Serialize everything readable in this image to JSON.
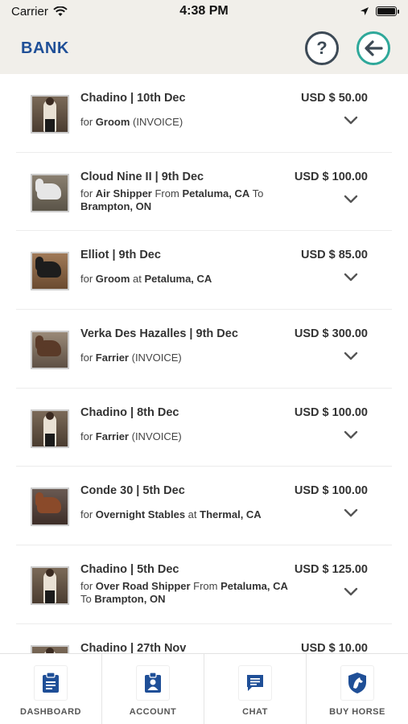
{
  "status": {
    "carrier": "Carrier",
    "time": "4:38 PM"
  },
  "header": {
    "title": "BANK",
    "help_label": "?"
  },
  "transactions": [
    {
      "title": "Chadino | 10th Dec",
      "amount": "USD $ 50.00",
      "sub": [
        "for ",
        {
          "b": "Groom"
        },
        " (INVOICE)"
      ]
    },
    {
      "title": "Cloud Nine II | 9th Dec",
      "amount": "USD $ 100.00",
      "sub": [
        "for ",
        {
          "b": "Air Shipper"
        },
        " From ",
        {
          "b": "Petaluma, CA"
        },
        " To ",
        {
          "b": "Brampton, ON"
        }
      ]
    },
    {
      "title": "Elliot | 9th Dec",
      "amount": "USD $ 85.00",
      "sub": [
        "for ",
        {
          "b": "Groom"
        },
        " at ",
        {
          "b": "Petaluma, CA"
        }
      ]
    },
    {
      "title": "Verka Des Hazalles | 9th Dec",
      "amount": "USD $ 300.00",
      "sub": [
        "for ",
        {
          "b": "Farrier"
        },
        " (INVOICE)"
      ]
    },
    {
      "title": "Chadino | 8th Dec",
      "amount": "USD $ 100.00",
      "sub": [
        "for ",
        {
          "b": "Farrier"
        },
        " (INVOICE)"
      ]
    },
    {
      "title": "Conde 30 | 5th Dec",
      "amount": "USD $ 100.00",
      "sub": [
        "for ",
        {
          "b": "Overnight Stables"
        },
        " at ",
        {
          "b": "Thermal, CA"
        }
      ]
    },
    {
      "title": "Chadino | 5th Dec",
      "amount": "USD $ 125.00",
      "sub": [
        "for ",
        {
          "b": "Over Road Shipper"
        },
        " From ",
        {
          "b": "Petaluma, CA"
        },
        " To ",
        {
          "b": "Brampton, ON"
        }
      ]
    },
    {
      "title": "Chadino | 27th Nov",
      "amount": "USD $ 10.00",
      "sub": []
    }
  ],
  "tabs": [
    {
      "label": "DASHBOARD",
      "icon": "clipboard-icon"
    },
    {
      "label": "ACCOUNT",
      "icon": "id-badge-icon"
    },
    {
      "label": "CHAT",
      "icon": "chat-icon"
    },
    {
      "label": "BUY HORSE",
      "icon": "horse-shield-icon"
    }
  ],
  "colors": {
    "brand": "#1f4f97",
    "back_accent": "#2fa89a"
  }
}
